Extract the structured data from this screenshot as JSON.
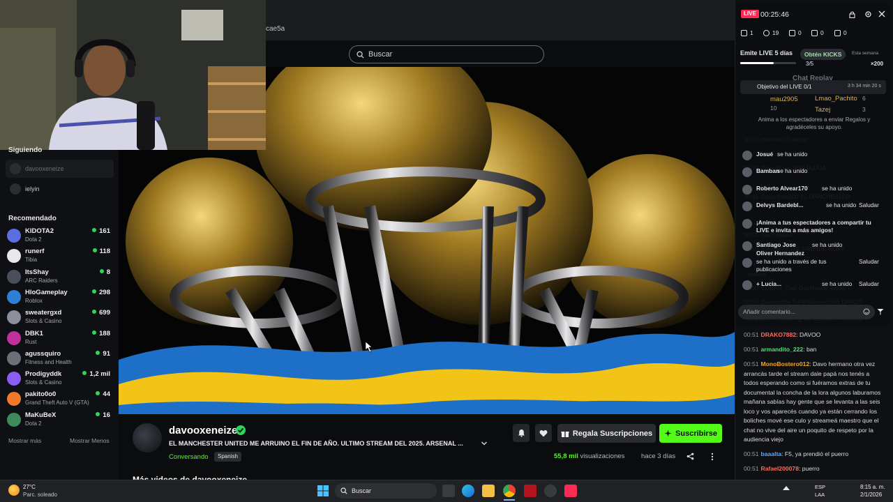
{
  "browser": {
    "url_fragment": "cae5a"
  },
  "search": {
    "placeholder": "Buscar"
  },
  "sidebar": {
    "following_heading": "Siguiendo",
    "following": [
      {
        "name": "davooxeneize"
      },
      {
        "name": "ielyin"
      }
    ],
    "recommended_heading": "Recomendado",
    "recommended": [
      {
        "name": "KIDOTA2",
        "category": "Dota 2",
        "viewers": "161",
        "color": "#5a6ee0"
      },
      {
        "name": "runerf",
        "category": "Tibia",
        "viewers": "118",
        "color": "#e8e8e8"
      },
      {
        "name": "ItsShay",
        "category": "ARC Raiders",
        "viewers": "8",
        "color": "#4a4f5c"
      },
      {
        "name": "HloGameplay",
        "category": "Roblox",
        "viewers": "298",
        "color": "#2f7fd6"
      },
      {
        "name": "sweatergxd",
        "category": "Slots & Casino",
        "viewers": "699",
        "color": "#8a8f99"
      },
      {
        "name": "DBK1",
        "category": "Rust",
        "viewers": "188",
        "color": "#c2309a"
      },
      {
        "name": "agussquiro",
        "category": "Fitness and Health",
        "viewers": "91",
        "color": "#6b6f78"
      },
      {
        "name": "Prodigyddk",
        "category": "Slots & Casino",
        "viewers": "1,2 mil",
        "color": "#8b5cf6"
      },
      {
        "name": "pakito0o0",
        "category": "Grand Theft Auto V (GTA)",
        "viewers": "44",
        "color": "#f07a2a"
      },
      {
        "name": "MaKuBeX",
        "category": "Dota 2",
        "viewers": "16",
        "color": "#3e8a5a"
      }
    ],
    "show_more": "Mostrar más",
    "show_less": "Mostrar Menos"
  },
  "stream": {
    "streamer": "davooxeneize",
    "title": "EL MANCHESTER UNITED ME ARRUINO EL FIN DE AÑO. ULTIMO STREAM DEL 2025. ARSENAL ...",
    "status": "Conversando",
    "language": "Spanish",
    "views_count": "55,8 mil",
    "views_label": "visualizaciones",
    "ago": "hace 3 días",
    "gift_label": "Regala Suscripciones",
    "subscribe_label": "Suscribirse",
    "more_videos": "Más videos de davooxeneize"
  },
  "live_overlay": {
    "live_badge": "LIVE",
    "timer": "00:25:46",
    "stats": [
      "1",
      "19",
      "0",
      "0",
      "0"
    ],
    "streak_label": "Emite LIVE 5 días",
    "streak_progress": "3/5",
    "streak_fraction": 0.6,
    "kicks_label": "Obtén KICKS",
    "week_label": "Esta semana",
    "multiplier": "×200",
    "objective_label": "Objetivo del LIVE 0/1",
    "objective_time": "3 h 34 min 20 s",
    "ranking": [
      {
        "name": "mau2905",
        "points": "10"
      },
      {
        "name": "Lmao_Pachito",
        "points": "6"
      },
      {
        "name": "Tazej",
        "points": "3"
      }
    ],
    "encourage_text": "Anima a los espectadores a enviar Regalos y agradéceles su apoyo.",
    "events": [
      {
        "user": "Josué",
        "text": "se ha unido",
        "action": ""
      },
      {
        "user": "Bamban",
        "text": "se ha unido",
        "action": ""
      },
      {
        "user": "Roberto Alvear170",
        "text": "se ha unido",
        "action": ""
      },
      {
        "user": "Delvys Bardebl...",
        "text": "se ha unido",
        "action": "Saludar"
      },
      {
        "user": "",
        "text": "¡Anima a tus espectadores a compartir tu LIVE e invita a más amigos!",
        "action": ""
      },
      {
        "user": "Santiago Jose",
        "text": "se ha unido",
        "action": ""
      },
      {
        "user": "Oliver Hernandez",
        "text": "se ha unido a través de tus publicaciones",
        "action": "Saludar"
      },
      {
        "user": "+ Lucia...",
        "text": "se ha unido",
        "action": "Saludar"
      }
    ],
    "comment_placeholder": "Añadir comentario..."
  },
  "chat": {
    "replay_label": "Chat Replay",
    "ghost_lines": [
      {
        "time": "00:48",
        "user": "mateitoo77",
        "text": "davoo"
      },
      {
        "time": "00:49",
        "user": "DiegoBoca",
        "text": "JAJAJAJAJA"
      },
      {
        "time": "00:49",
        "user": "Danielinho000",
        "text": "EL MANCHESTER"
      },
      {
        "time": "00:50",
        "user": "chuchiman4",
        "text": ""
      },
      {
        "time": "00:50",
        "user": "MAGBOMOXE",
        "text": "PRENDE HOY?"
      },
      {
        "time": "",
        "user": "",
        "text": "puerro"
      },
      {
        "time": "00:50",
        "user": "EL BAR_Cavi",
        "text": "Gonchester kakas"
      },
      {
        "time": "00:50",
        "user": "DavoooSoyTuFanNumeroUno",
        "text": "DAVOO"
      },
      {
        "time": "",
        "user": "",
        "text": "ANDA A TU CASA Q SE LE CORTA LA LUZ"
      }
    ],
    "messages": [
      {
        "time": "00:51",
        "user": "DRAKO7882",
        "text": "DAVOO",
        "color": "#ff6a5a"
      },
      {
        "time": "00:51",
        "user": "armandito_222",
        "text": "ban",
        "color": "#4ee07a"
      },
      {
        "time": "00:51",
        "user": "MonoBostero012",
        "text": "Davo hermano otra vez arrancás tarde el stream dale papá nos tenés a todos esperando como si fuéramos extras de tu documental la concha de la lora algunos laburamos mañana sabías hay gente que se levanta a las seis loco y vos aparecés cuando ya están cerrando los boliches mové ese culo y streameá maestro que el chat no vive del aire un poquito de respeto por la audiencia viejo",
        "color": "#f5a623"
      },
      {
        "time": "00:51",
        "user": "baaalta",
        "text": "F5, ya prendió el puerro",
        "color": "#5aa9ff"
      },
      {
        "time": "00:51",
        "user": "Rafael200078",
        "text": "puerro",
        "color": "#ff6a5a"
      }
    ]
  },
  "taskbar": {
    "weather_temp": "27°C",
    "weather_desc": "Parc. soleado",
    "search_label": "Buscar",
    "lang_top": "ESP",
    "lang_bottom": "LAA",
    "time": "8:15 a. m.",
    "date": "2/1/2026"
  }
}
